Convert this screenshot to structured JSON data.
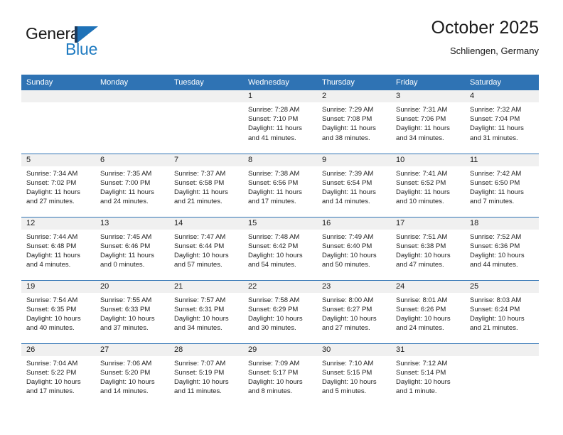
{
  "brand": {
    "name_part1": "General",
    "name_part2": "Blue",
    "mark": "blue-flag-triangle"
  },
  "header": {
    "title": "October 2025",
    "subtitle": "Schliengen, Germany"
  },
  "colors": {
    "header_blue": "#2f73b4",
    "brand_blue": "#1f7bc1",
    "daynum_band": "#f0f0f0",
    "text": "#1a1a1a"
  },
  "calendar": {
    "weekday_headers": [
      "Sunday",
      "Monday",
      "Tuesday",
      "Wednesday",
      "Thursday",
      "Friday",
      "Saturday"
    ],
    "weeks": [
      [
        {
          "empty": true,
          "day": "",
          "sunrise": "",
          "sunset": "",
          "daylight1": "",
          "daylight2": ""
        },
        {
          "empty": true,
          "day": "",
          "sunrise": "",
          "sunset": "",
          "daylight1": "",
          "daylight2": ""
        },
        {
          "empty": true,
          "day": "",
          "sunrise": "",
          "sunset": "",
          "daylight1": "",
          "daylight2": ""
        },
        {
          "empty": false,
          "day": "1",
          "sunrise": "Sunrise: 7:28 AM",
          "sunset": "Sunset: 7:10 PM",
          "daylight1": "Daylight: 11 hours",
          "daylight2": "and 41 minutes."
        },
        {
          "empty": false,
          "day": "2",
          "sunrise": "Sunrise: 7:29 AM",
          "sunset": "Sunset: 7:08 PM",
          "daylight1": "Daylight: 11 hours",
          "daylight2": "and 38 minutes."
        },
        {
          "empty": false,
          "day": "3",
          "sunrise": "Sunrise: 7:31 AM",
          "sunset": "Sunset: 7:06 PM",
          "daylight1": "Daylight: 11 hours",
          "daylight2": "and 34 minutes."
        },
        {
          "empty": false,
          "day": "4",
          "sunrise": "Sunrise: 7:32 AM",
          "sunset": "Sunset: 7:04 PM",
          "daylight1": "Daylight: 11 hours",
          "daylight2": "and 31 minutes."
        }
      ],
      [
        {
          "empty": false,
          "day": "5",
          "sunrise": "Sunrise: 7:34 AM",
          "sunset": "Sunset: 7:02 PM",
          "daylight1": "Daylight: 11 hours",
          "daylight2": "and 27 minutes."
        },
        {
          "empty": false,
          "day": "6",
          "sunrise": "Sunrise: 7:35 AM",
          "sunset": "Sunset: 7:00 PM",
          "daylight1": "Daylight: 11 hours",
          "daylight2": "and 24 minutes."
        },
        {
          "empty": false,
          "day": "7",
          "sunrise": "Sunrise: 7:37 AM",
          "sunset": "Sunset: 6:58 PM",
          "daylight1": "Daylight: 11 hours",
          "daylight2": "and 21 minutes."
        },
        {
          "empty": false,
          "day": "8",
          "sunrise": "Sunrise: 7:38 AM",
          "sunset": "Sunset: 6:56 PM",
          "daylight1": "Daylight: 11 hours",
          "daylight2": "and 17 minutes."
        },
        {
          "empty": false,
          "day": "9",
          "sunrise": "Sunrise: 7:39 AM",
          "sunset": "Sunset: 6:54 PM",
          "daylight1": "Daylight: 11 hours",
          "daylight2": "and 14 minutes."
        },
        {
          "empty": false,
          "day": "10",
          "sunrise": "Sunrise: 7:41 AM",
          "sunset": "Sunset: 6:52 PM",
          "daylight1": "Daylight: 11 hours",
          "daylight2": "and 10 minutes."
        },
        {
          "empty": false,
          "day": "11",
          "sunrise": "Sunrise: 7:42 AM",
          "sunset": "Sunset: 6:50 PM",
          "daylight1": "Daylight: 11 hours",
          "daylight2": "and 7 minutes."
        }
      ],
      [
        {
          "empty": false,
          "day": "12",
          "sunrise": "Sunrise: 7:44 AM",
          "sunset": "Sunset: 6:48 PM",
          "daylight1": "Daylight: 11 hours",
          "daylight2": "and 4 minutes."
        },
        {
          "empty": false,
          "day": "13",
          "sunrise": "Sunrise: 7:45 AM",
          "sunset": "Sunset: 6:46 PM",
          "daylight1": "Daylight: 11 hours",
          "daylight2": "and 0 minutes."
        },
        {
          "empty": false,
          "day": "14",
          "sunrise": "Sunrise: 7:47 AM",
          "sunset": "Sunset: 6:44 PM",
          "daylight1": "Daylight: 10 hours",
          "daylight2": "and 57 minutes."
        },
        {
          "empty": false,
          "day": "15",
          "sunrise": "Sunrise: 7:48 AM",
          "sunset": "Sunset: 6:42 PM",
          "daylight1": "Daylight: 10 hours",
          "daylight2": "and 54 minutes."
        },
        {
          "empty": false,
          "day": "16",
          "sunrise": "Sunrise: 7:49 AM",
          "sunset": "Sunset: 6:40 PM",
          "daylight1": "Daylight: 10 hours",
          "daylight2": "and 50 minutes."
        },
        {
          "empty": false,
          "day": "17",
          "sunrise": "Sunrise: 7:51 AM",
          "sunset": "Sunset: 6:38 PM",
          "daylight1": "Daylight: 10 hours",
          "daylight2": "and 47 minutes."
        },
        {
          "empty": false,
          "day": "18",
          "sunrise": "Sunrise: 7:52 AM",
          "sunset": "Sunset: 6:36 PM",
          "daylight1": "Daylight: 10 hours",
          "daylight2": "and 44 minutes."
        }
      ],
      [
        {
          "empty": false,
          "day": "19",
          "sunrise": "Sunrise: 7:54 AM",
          "sunset": "Sunset: 6:35 PM",
          "daylight1": "Daylight: 10 hours",
          "daylight2": "and 40 minutes."
        },
        {
          "empty": false,
          "day": "20",
          "sunrise": "Sunrise: 7:55 AM",
          "sunset": "Sunset: 6:33 PM",
          "daylight1": "Daylight: 10 hours",
          "daylight2": "and 37 minutes."
        },
        {
          "empty": false,
          "day": "21",
          "sunrise": "Sunrise: 7:57 AM",
          "sunset": "Sunset: 6:31 PM",
          "daylight1": "Daylight: 10 hours",
          "daylight2": "and 34 minutes."
        },
        {
          "empty": false,
          "day": "22",
          "sunrise": "Sunrise: 7:58 AM",
          "sunset": "Sunset: 6:29 PM",
          "daylight1": "Daylight: 10 hours",
          "daylight2": "and 30 minutes."
        },
        {
          "empty": false,
          "day": "23",
          "sunrise": "Sunrise: 8:00 AM",
          "sunset": "Sunset: 6:27 PM",
          "daylight1": "Daylight: 10 hours",
          "daylight2": "and 27 minutes."
        },
        {
          "empty": false,
          "day": "24",
          "sunrise": "Sunrise: 8:01 AM",
          "sunset": "Sunset: 6:26 PM",
          "daylight1": "Daylight: 10 hours",
          "daylight2": "and 24 minutes."
        },
        {
          "empty": false,
          "day": "25",
          "sunrise": "Sunrise: 8:03 AM",
          "sunset": "Sunset: 6:24 PM",
          "daylight1": "Daylight: 10 hours",
          "daylight2": "and 21 minutes."
        }
      ],
      [
        {
          "empty": false,
          "day": "26",
          "sunrise": "Sunrise: 7:04 AM",
          "sunset": "Sunset: 5:22 PM",
          "daylight1": "Daylight: 10 hours",
          "daylight2": "and 17 minutes."
        },
        {
          "empty": false,
          "day": "27",
          "sunrise": "Sunrise: 7:06 AM",
          "sunset": "Sunset: 5:20 PM",
          "daylight1": "Daylight: 10 hours",
          "daylight2": "and 14 minutes."
        },
        {
          "empty": false,
          "day": "28",
          "sunrise": "Sunrise: 7:07 AM",
          "sunset": "Sunset: 5:19 PM",
          "daylight1": "Daylight: 10 hours",
          "daylight2": "and 11 minutes."
        },
        {
          "empty": false,
          "day": "29",
          "sunrise": "Sunrise: 7:09 AM",
          "sunset": "Sunset: 5:17 PM",
          "daylight1": "Daylight: 10 hours",
          "daylight2": "and 8 minutes."
        },
        {
          "empty": false,
          "day": "30",
          "sunrise": "Sunrise: 7:10 AM",
          "sunset": "Sunset: 5:15 PM",
          "daylight1": "Daylight: 10 hours",
          "daylight2": "and 5 minutes."
        },
        {
          "empty": false,
          "day": "31",
          "sunrise": "Sunrise: 7:12 AM",
          "sunset": "Sunset: 5:14 PM",
          "daylight1": "Daylight: 10 hours",
          "daylight2": "and 1 minute."
        },
        {
          "empty": true,
          "day": "",
          "sunrise": "",
          "sunset": "",
          "daylight1": "",
          "daylight2": ""
        }
      ]
    ]
  }
}
